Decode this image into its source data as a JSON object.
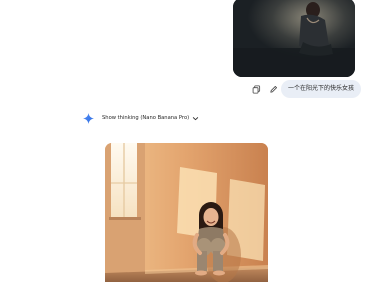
{
  "user_message": {
    "image_alt": "user attached image",
    "text": "一个在阳光下的快乐女孩",
    "actions": [
      {
        "name": "copy-icon"
      },
      {
        "name": "edit-icon"
      }
    ]
  },
  "assistant": {
    "icon": "gemini-spark-icon",
    "thinking_label": "Show thinking (Nano Banana Pro)",
    "toggle_icon": "chevron-down-icon",
    "spark_color": "#4285f4"
  },
  "generated_image": {
    "alt": "generated image"
  }
}
